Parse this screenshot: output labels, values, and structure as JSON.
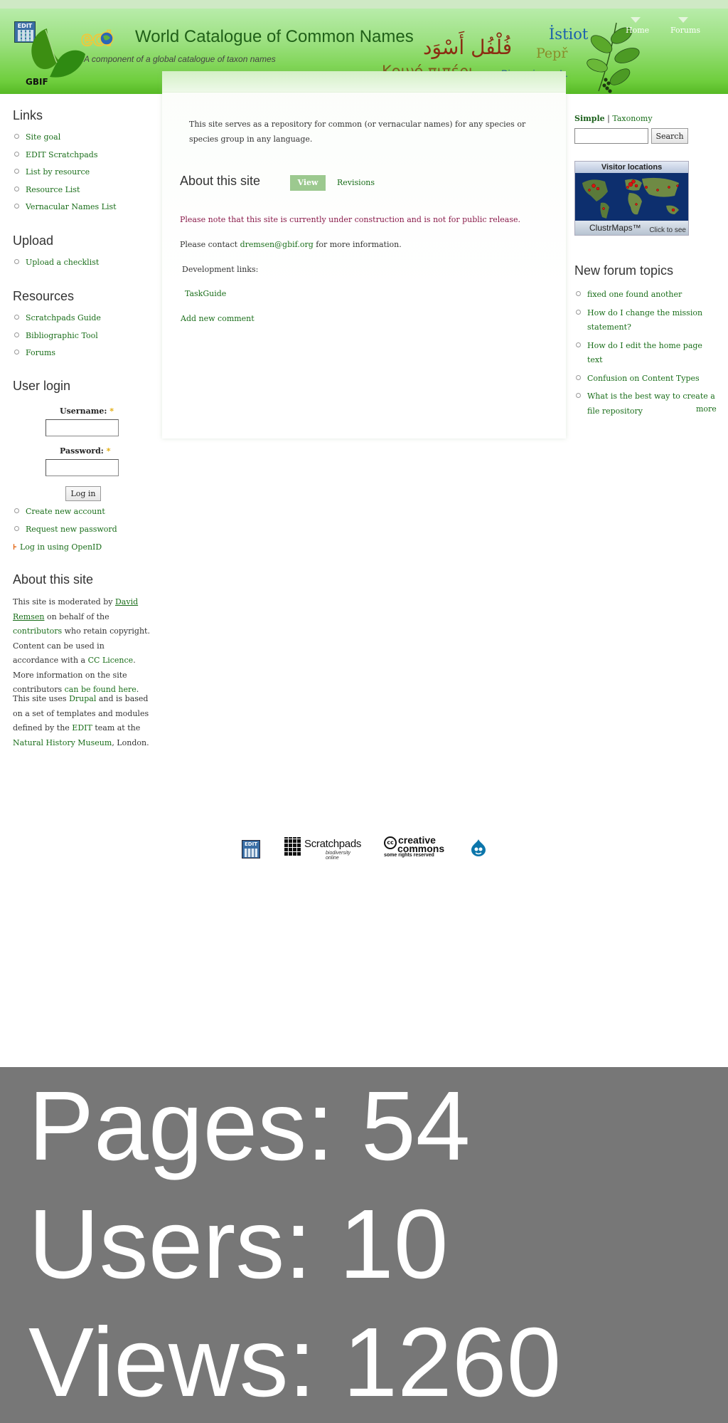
{
  "header": {
    "edit_logo_text": "EDIT",
    "gbif_text": "GBIF",
    "eol_text": "eol",
    "title": "World Catalogue of Common Names",
    "slogan": "A component of a global catalogue of taxon names",
    "names": {
      "arabic": "فُلْفُل أَسْوَد",
      "istiot": "İstiot",
      "pepr": "Pepř",
      "greek": "Κοινό πιπέρι",
      "piper_genus": "Piper nigrum",
      "piper_author": " L."
    },
    "nav": {
      "home": "Home",
      "forums": "Forums"
    }
  },
  "main": {
    "mission": "This site serves as a repository for common (or vernacular names) for any species or species group in any language.",
    "page_title": "About this site",
    "tabs": {
      "view": "View",
      "revisions": "Revisions"
    },
    "notice": "Please note that this site is currently under construction and is not for public release.",
    "contact_prefix": "Please contact ",
    "contact_email": "dremsen@gbif.org",
    "contact_suffix": " for more information.",
    "dev_links_label": "Development links:",
    "taskguide": "TaskGuide",
    "add_comment": "Add new comment"
  },
  "left_sidebar": {
    "links": {
      "title": "Links",
      "items": [
        "Site goal",
        "EDIT Scratchpads",
        "List by resource",
        "Resource List",
        "Vernacular Names List"
      ]
    },
    "upload": {
      "title": "Upload",
      "items": [
        "Upload a checklist"
      ]
    },
    "resources": {
      "title": "Resources",
      "items": [
        "Scratchpads Guide",
        "Bibliographic Tool",
        "Forums"
      ]
    },
    "login": {
      "title": "User login",
      "username_label": "Username: ",
      "password_label": "Password: ",
      "required_mark": "*",
      "button": "Log in",
      "links": [
        "Create new account",
        "Request new password"
      ],
      "openid": "Log in using OpenID"
    },
    "about": {
      "title": "About this site",
      "p1": {
        "t1": "This site is moderated by ",
        "moderator": "David Remsen",
        "t2": " on behalf of the ",
        "contributors": "contributors",
        "t3": " who retain copyright. Content can be used in accordance with a ",
        "licence": "CC Licence",
        "t4": ". More information on the site contributors ",
        "found": "can be found here",
        "t5": "."
      },
      "p2": {
        "t1": "This site uses ",
        "drupal": "Drupal",
        "t2": " and is based on a set of templates and modules defined by the ",
        "edit": "EDIT",
        "t3": " team at the ",
        "nhm": "Natural History Museum",
        "t4": ", London."
      }
    }
  },
  "right_sidebar": {
    "search": {
      "tab_simple": "Simple",
      "separator": " | ",
      "tab_taxonomy": "Taxonomy",
      "button": "Search",
      "value": ""
    },
    "clustrmap": {
      "header": "Visitor locations",
      "brand": "ClustrMaps™",
      "click": "Click to see"
    },
    "forum": {
      "title": "New forum topics",
      "items": [
        "fixed one found another",
        "How do I change the mission statement?",
        "How do I edit the home page text",
        "Confusion on Content Types",
        "What is the best way to create a file repository"
      ],
      "more": "more"
    }
  },
  "footer": {
    "edit": "EDIT",
    "scratchpads_name": "Scratchpads",
    "scratchpads_sub": "biodiversity online",
    "cc_logo": "cc",
    "cc_line1": "creative",
    "cc_line2": "commons",
    "cc_line3": "some rights reserved"
  },
  "stats": {
    "pages": "Pages: 54",
    "users": "Users: 10",
    "views": "Views: 1260"
  },
  "colors": {
    "link": "#1a6e1a",
    "header_green": "#6fce3d",
    "tab_active": "#9cc98f",
    "notice": "#8a1a4a",
    "stats_bg": "#777777"
  }
}
